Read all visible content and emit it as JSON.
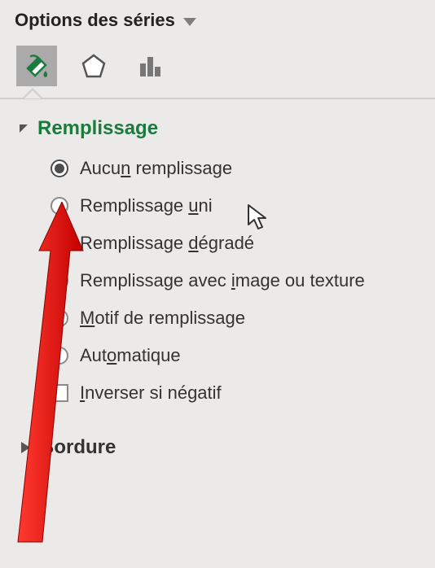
{
  "header": {
    "title": "Options des séries"
  },
  "tabs": {
    "fill_icon": "fill-paint-icon",
    "effects_icon": "pentagon-icon",
    "series_icon": "bar-chart-icon",
    "selected": 0
  },
  "fill_section": {
    "title": "Remplissage",
    "expanded": true,
    "options": [
      {
        "key": "none",
        "pre": "Aucu",
        "ul": "n",
        "post": " remplissage",
        "selected": true
      },
      {
        "key": "solid",
        "pre": "Remplissage ",
        "ul": "u",
        "post": "ni",
        "selected": false
      },
      {
        "key": "gradient",
        "pre": "Remplissage ",
        "ul": "d",
        "post": "égradé",
        "selected": false
      },
      {
        "key": "picture",
        "pre": "Remplissage avec ",
        "ul": "i",
        "post": "mage ou texture",
        "selected": false
      },
      {
        "key": "pattern",
        "pre": "",
        "ul": "M",
        "post": "otif de remplissage",
        "selected": false
      },
      {
        "key": "auto",
        "pre": "Aut",
        "ul": "o",
        "post": "matique",
        "selected": false
      }
    ],
    "invert": {
      "pre": "",
      "ul": "I",
      "post": "nverser si négatif",
      "checked": false
    }
  },
  "border_section": {
    "title": "Bordure",
    "expanded": false
  }
}
